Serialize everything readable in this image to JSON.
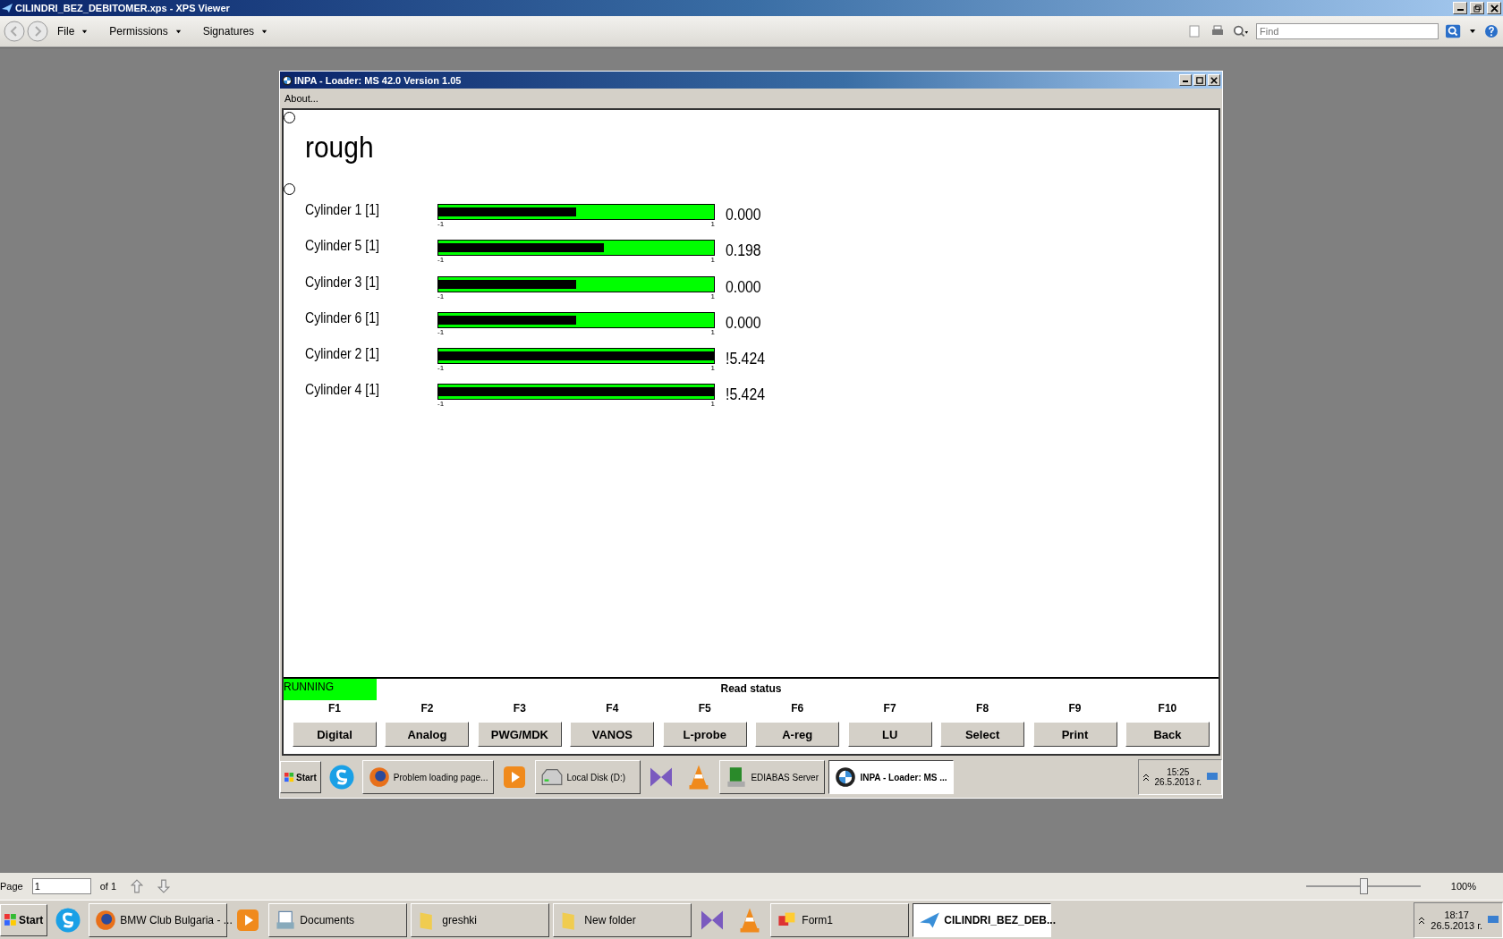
{
  "window": {
    "title": "CILINDRI_BEZ_DEBITOMER.xps - XPS Viewer"
  },
  "menus": [
    {
      "label": "File"
    },
    {
      "label": "Permissions"
    },
    {
      "label": "Signatures"
    }
  ],
  "search": {
    "placeholder": "Find"
  },
  "inpa": {
    "title": "INPA - Loader:  MS 42.0 Version 1.05",
    "menu": "About...",
    "heading": "rough",
    "gauges": [
      {
        "label": "Cylinder 1 [1]",
        "level": 0.5,
        "min": "-1",
        "max": "1",
        "reading": "0.000"
      },
      {
        "label": "Cylinder 5 [1]",
        "level": 0.6,
        "min": "-1",
        "max": "1",
        "reading": "0.198"
      },
      {
        "label": "Cylinder 3 [1]",
        "level": 0.5,
        "min": "-1",
        "max": "1",
        "reading": "0.000"
      },
      {
        "label": "Cylinder 6 [1]",
        "level": 0.5,
        "min": "-1",
        "max": "1",
        "reading": "0.000"
      },
      {
        "label": "Cylinder 2 [1]",
        "level": 1,
        "min": "-1",
        "max": "1",
        "reading": "!5.424"
      },
      {
        "label": "Cylinder 4 [1]",
        "level": 1,
        "min": "-1",
        "max": "1",
        "reading": "!5.424"
      }
    ],
    "status": {
      "state": "RUNNING",
      "message": "Read status"
    },
    "function_keys": [
      {
        "key": "F1",
        "label": "Digital"
      },
      {
        "key": "F2",
        "label": "Analog"
      },
      {
        "key": "F3",
        "label": "PWG/MDK"
      },
      {
        "key": "F4",
        "label": "VANOS"
      },
      {
        "key": "F5",
        "label": "L-probe"
      },
      {
        "key": "F6",
        "label": "A-reg"
      },
      {
        "key": "F7",
        "label": "LU"
      },
      {
        "key": "F8",
        "label": "Select"
      },
      {
        "key": "F9",
        "label": "Print"
      },
      {
        "key": "F10",
        "label": "Back"
      }
    ],
    "taskbar": {
      "start": "Start",
      "items": [
        {
          "kind": "skype",
          "selected": false
        },
        {
          "kind": "firefox",
          "label": "Problem loading page...",
          "selected": false
        },
        {
          "kind": "media",
          "selected": false
        },
        {
          "kind": "drive",
          "label": "Local Disk (D:)",
          "selected": false
        },
        {
          "kind": "vs",
          "selected": false
        },
        {
          "kind": "vlc",
          "selected": false
        },
        {
          "kind": "ediabas",
          "label": "EDIABAS Server",
          "selected": false
        },
        {
          "kind": "bmw",
          "label": "INPA - Loader:  MS ...",
          "selected": true
        }
      ],
      "time": "15:25",
      "date": "26.5.2013 г."
    }
  },
  "page_bar": {
    "label": "Page",
    "value": "1",
    "of": "of 1",
    "zoom": "100%",
    "zoom_slider": {
      "level": 0.5
    }
  },
  "taskbar": {
    "start": "Start",
    "items": [
      {
        "kind": "skype",
        "selected": false
      },
      {
        "kind": "firefox",
        "label": "BMW Club Bulgaria - ...",
        "selected": false
      },
      {
        "kind": "media",
        "selected": false
      },
      {
        "kind": "documents",
        "label": "Documents",
        "selected": false
      },
      {
        "kind": "folder",
        "label": "greshki",
        "selected": false
      },
      {
        "kind": "folder",
        "label": "New folder",
        "selected": false
      },
      {
        "kind": "vs",
        "selected": false
      },
      {
        "kind": "vlc",
        "selected": false
      },
      {
        "kind": "form",
        "label": "Form1",
        "selected": false
      },
      {
        "kind": "xps",
        "label": "CILINDRI_BEZ_DEB...",
        "selected": true
      }
    ],
    "time": "18:17",
    "date": "26.5.2013 г."
  }
}
